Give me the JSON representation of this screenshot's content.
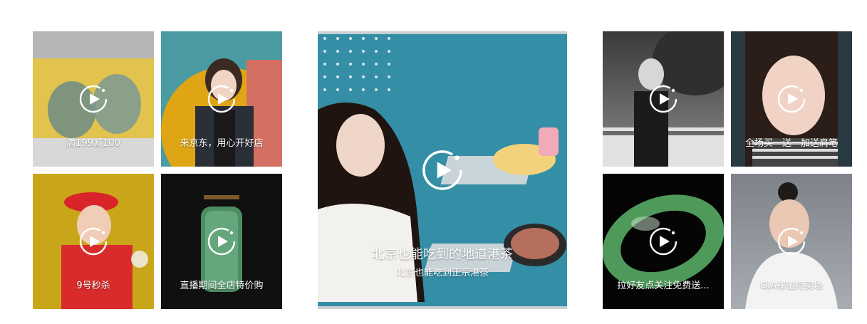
{
  "icons": {
    "play": "play-circle-icon"
  },
  "left_group": {
    "tiles": [
      {
        "caption": "满199减100",
        "bg": "#b8b8b8"
      },
      {
        "caption": "来京东，用心开好店",
        "bg": "#4a9aa0"
      },
      {
        "caption": "9号秒杀",
        "bg": "#c9a619"
      },
      {
        "caption": "直播期间全店特价购",
        "bg": "#0f0f0f"
      }
    ]
  },
  "feature": {
    "title": "北京也能吃到的地道港茶",
    "subtitle": "北京也能吃到正宗港茶",
    "bg": "#348ea6"
  },
  "right_group": {
    "tiles": [
      {
        "caption": "",
        "bg": "#5b5b5b"
      },
      {
        "caption": "全场买一送一加送肩笔",
        "bg": "#2a3a42"
      },
      {
        "caption": "拉好友点关注免费送...",
        "bg": "#050505"
      },
      {
        "caption": "GIA裸钻特卖场",
        "bg": "#8a8f96"
      }
    ]
  }
}
